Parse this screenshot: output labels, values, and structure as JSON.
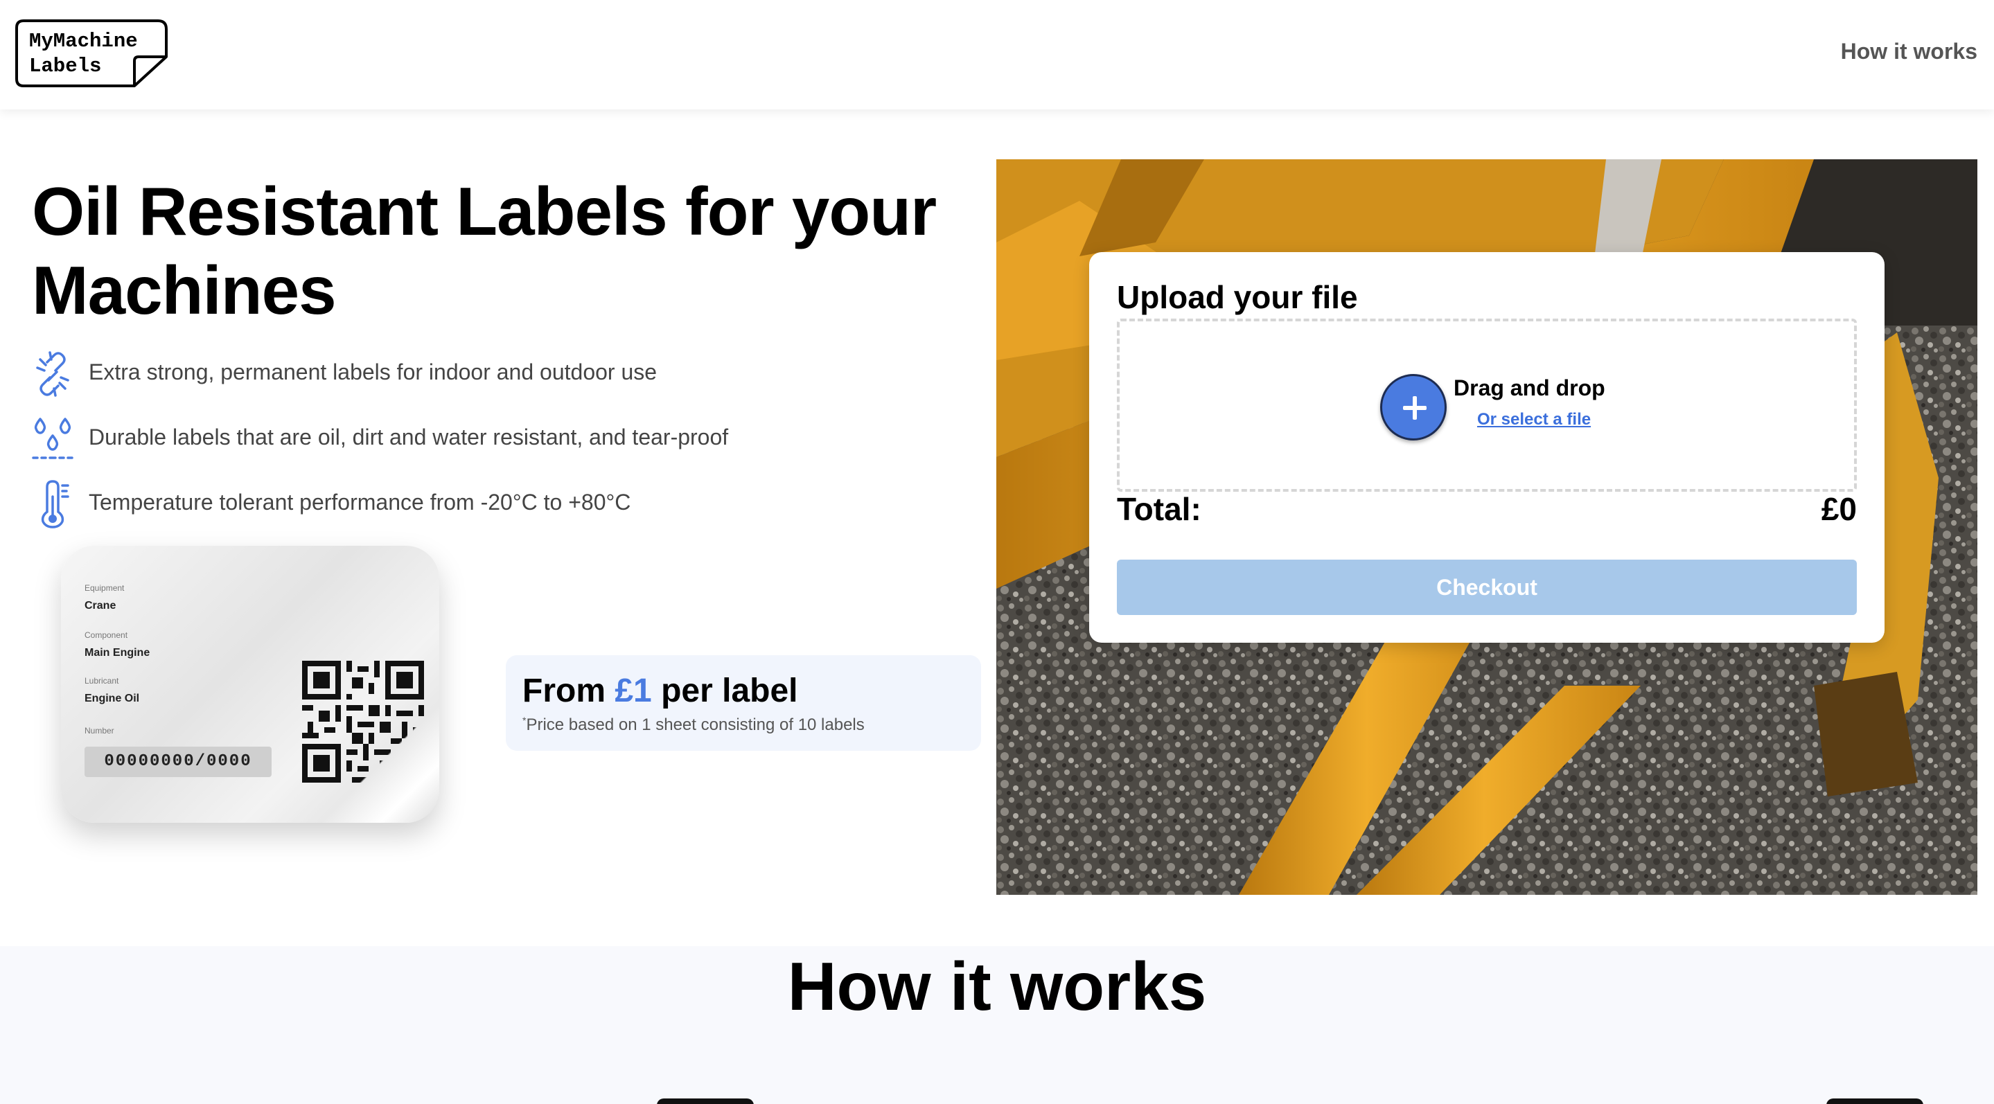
{
  "header": {
    "logo_line1": "MyMachine",
    "logo_line2": "Labels",
    "nav_how_it_works": "How it works"
  },
  "hero": {
    "title": "Oil Resistant Labels for your Machines",
    "features": [
      {
        "icon": "link-icon",
        "text": "Extra strong, permanent labels for indoor and outdoor use"
      },
      {
        "icon": "water-drops-icon",
        "text": "Durable labels that are oil, dirt and water resistant, and tear-proof"
      },
      {
        "icon": "thermometer-icon",
        "text": "Temperature tolerant performance from -20°C to +80°C"
      }
    ]
  },
  "label_sample": {
    "equipment_label": "Equipment",
    "equipment_value": "Crane",
    "component_label": "Component",
    "component_value": "Main Engine",
    "lubricant_label": "Lubricant",
    "lubricant_value": "Engine Oil",
    "number_label": "Number",
    "number_value": "00000000/0000"
  },
  "price": {
    "prefix": "From ",
    "amount": "£1",
    "suffix": " per label",
    "note_marker": "*",
    "note": "Price based on 1 sheet consisting of 10 labels"
  },
  "upload": {
    "title": "Upload your file",
    "drag_drop": "Drag and drop",
    "select_link": "Or select a file",
    "total_label": "Total:",
    "total_value": "£0",
    "checkout": "Checkout"
  },
  "how_it_works": {
    "title": "How it works"
  },
  "colors": {
    "accent": "#4a7be0",
    "checkout_disabled": "#a7c8ea",
    "machine_yellow": "#e8a425"
  }
}
